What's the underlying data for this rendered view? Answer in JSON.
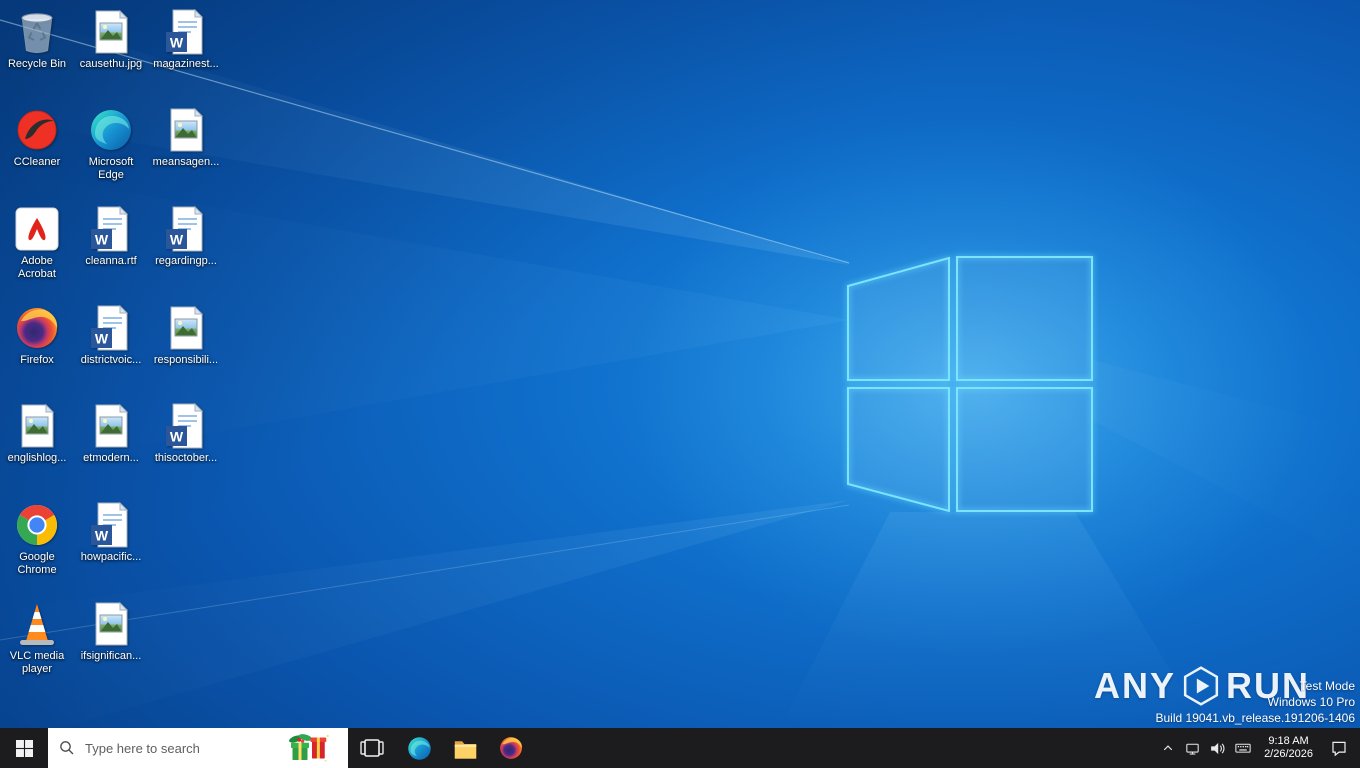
{
  "desktop": {
    "icons": [
      {
        "label": "Recycle Bin",
        "icon": "recycle-bin"
      },
      {
        "label": "CCleaner",
        "icon": "ccleaner"
      },
      {
        "label": "Adobe Acrobat",
        "icon": "adobe-acrobat"
      },
      {
        "label": "Firefox",
        "icon": "firefox"
      },
      {
        "label": "englishlog...",
        "icon": "image-file"
      },
      {
        "label": "Google Chrome",
        "icon": "google-chrome"
      },
      {
        "label": "VLC media player",
        "icon": "vlc-media-player"
      },
      {
        "label": "causethu.jpg",
        "icon": "image-file"
      },
      {
        "label": "Microsoft Edge",
        "icon": "microsoft-edge"
      },
      {
        "label": "cleanna.rtf",
        "icon": "word-document"
      },
      {
        "label": "districtvoic...",
        "icon": "word-document"
      },
      {
        "label": "etmodern...",
        "icon": "image-file"
      },
      {
        "label": "howpacific...",
        "icon": "word-document"
      },
      {
        "label": "ifsignifican...",
        "icon": "image-file"
      },
      {
        "label": "magazinest...",
        "icon": "word-document"
      },
      {
        "label": "meansagen...",
        "icon": "image-file"
      },
      {
        "label": "regardingp...",
        "icon": "word-document"
      },
      {
        "label": "responsibili...",
        "icon": "image-file"
      },
      {
        "label": "thisoctober...",
        "icon": "word-document"
      }
    ]
  },
  "watermark": {
    "brand_left": "ANY",
    "brand_right": "RUN",
    "lines": [
      "Test Mode",
      "Windows 10 Pro",
      "Build 19041.vb_release.191206-1406"
    ]
  },
  "taskbar": {
    "search_placeholder": "Type here to search",
    "pinned_apps": [
      "start",
      "task-view",
      "microsoft-edge",
      "file-explorer",
      "firefox"
    ],
    "tray_icons": [
      "hidden-icons-chevron",
      "network",
      "volume",
      "touch-keyboard",
      "action-center"
    ],
    "clock": {
      "time": "9:18 AM",
      "date": "2/26/2026"
    }
  }
}
